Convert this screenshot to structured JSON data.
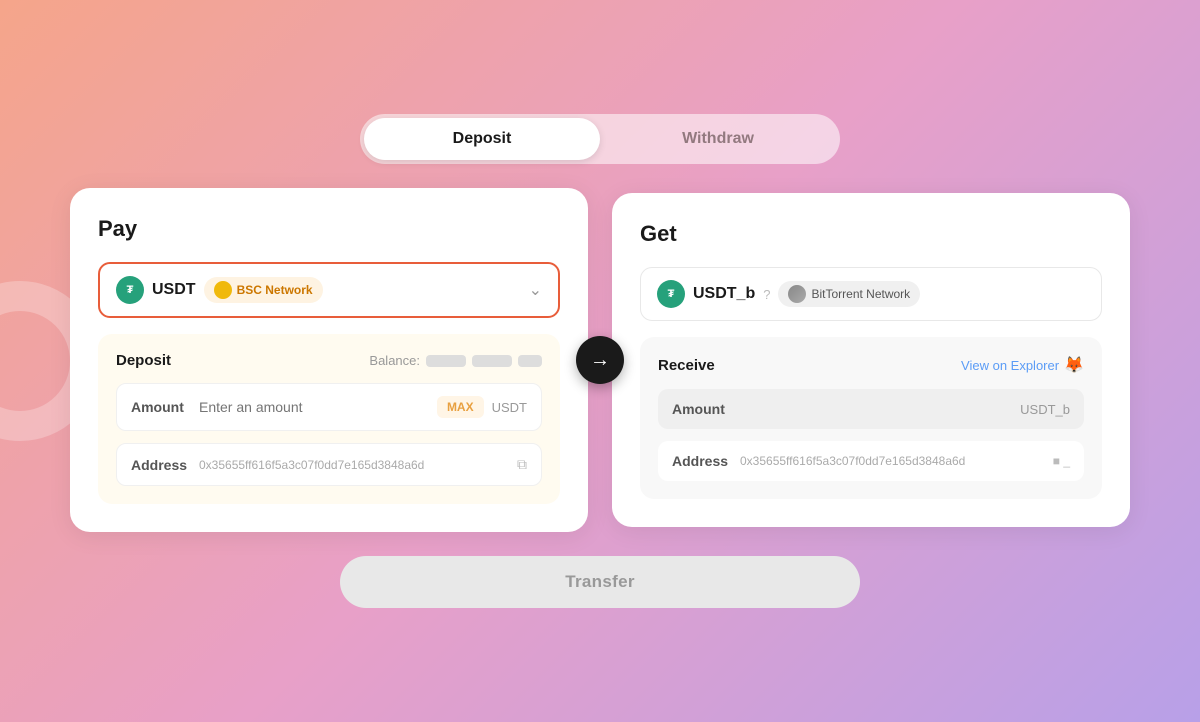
{
  "tabs": {
    "deposit": "Deposit",
    "withdraw": "Withdraw",
    "active": "deposit"
  },
  "pay_card": {
    "title": "Pay",
    "token": {
      "name": "USDT",
      "network": "BSC Network"
    },
    "deposit_section": {
      "label": "Deposit",
      "balance_label": "Balance:",
      "amount": {
        "label": "Amount",
        "placeholder": "Enter an amount",
        "max_btn": "MAX",
        "unit": "USDT"
      },
      "address": {
        "label": "Address",
        "value": "0x35655ff616f5a3c07f0dd7e165d3848a6d"
      }
    }
  },
  "get_card": {
    "title": "Get",
    "token": {
      "name": "USDT_b",
      "network": "BitTorrent Network"
    },
    "receive_section": {
      "label": "Receive",
      "view_explorer": "View on Explorer",
      "amount": {
        "label": "Amount",
        "unit": "USDT_b"
      },
      "address": {
        "label": "Address",
        "value": "0x35655ff616f5a3c07f0dd7e165d3848a6d"
      }
    }
  },
  "transfer_btn": "Transfer",
  "arrow": "→"
}
